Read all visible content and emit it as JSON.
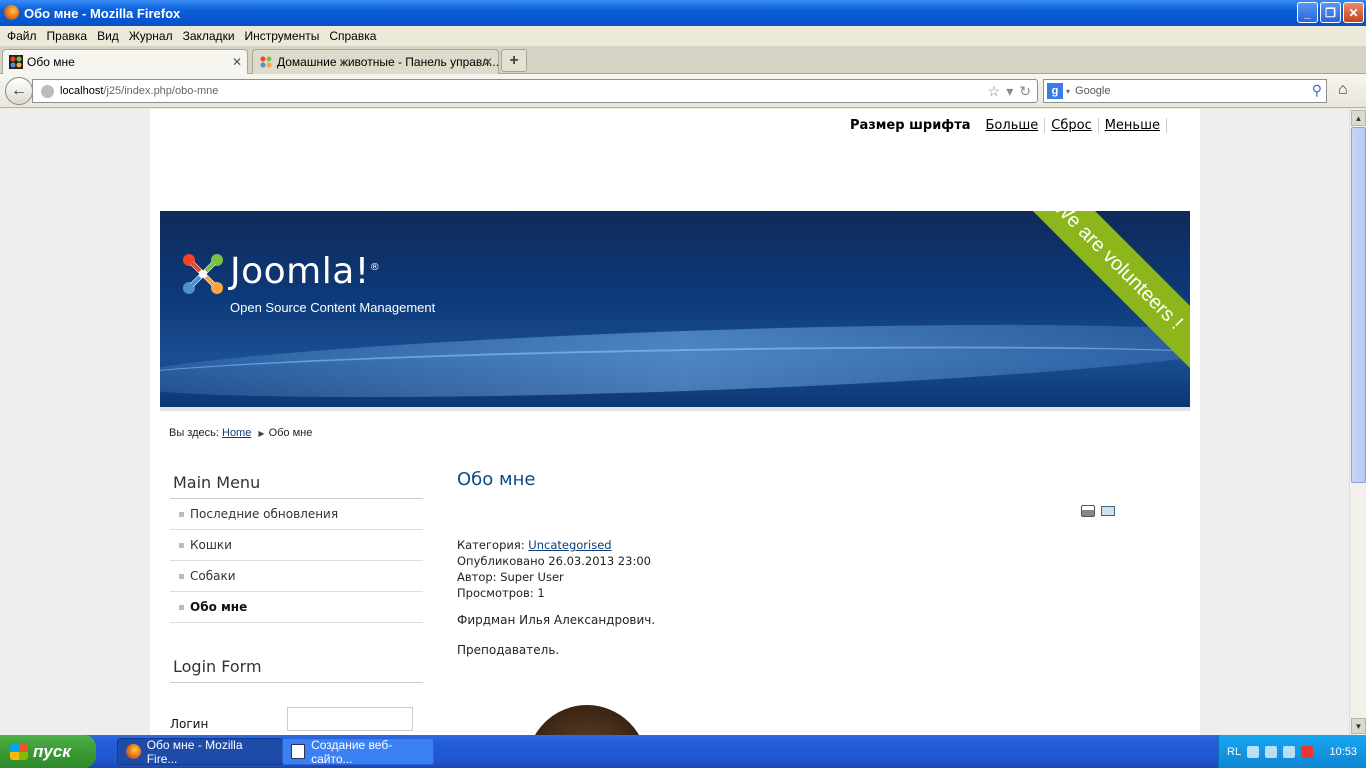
{
  "window": {
    "title": "Обо мне - Mozilla Firefox",
    "minimize": "_",
    "maximize": "❐",
    "close": "✕"
  },
  "menubar": [
    "Файл",
    "Правка",
    "Вид",
    "Журнал",
    "Закладки",
    "Инструменты",
    "Справка"
  ],
  "tabs": [
    {
      "label": "Обо мне",
      "close": "✕"
    },
    {
      "label": "Домашние животные - Панель управл...",
      "close": "✕"
    }
  ],
  "newtab": "+",
  "nav": {
    "back": "←",
    "url_host": "localhost",
    "url_path": "/j25/index.php/obo-mne",
    "star": "☆",
    "dropdown": "▾",
    "reload": "↻",
    "search_engine": "g",
    "search_placeholder": "Google",
    "search_icon": "⚲",
    "home": "⌂"
  },
  "site": {
    "fontsize_label": "Размер шрифта",
    "fontsize_bigger": "Больше",
    "fontsize_reset": "Сброс",
    "fontsize_smaller": "Меньше",
    "brand": "Joomla!",
    "brand_reg": "®",
    "tagline": "Open Source Content Management",
    "ribbon": "We are volunteers !",
    "breadcrumb_prefix": "Вы здесь:",
    "breadcrumb_home": "Home",
    "breadcrumb_current": "Обо мне"
  },
  "main_menu": {
    "title": "Main Menu",
    "items": [
      "Последние обновления",
      "Кошки",
      "Собаки",
      "Обо мне"
    ],
    "active_index": 3
  },
  "login": {
    "title": "Login Form",
    "username_label": "Логин"
  },
  "article": {
    "title": "Обо мне",
    "category_label": "Категория:",
    "category": "Uncategorised",
    "published": "Опубликовано 26.03.2013 23:00",
    "author": "Автор: Super User",
    "hits": "Просмотров: 1",
    "p1": "Фирдман Илья Александрович.",
    "p2": "Преподаватель."
  },
  "taskbar": {
    "start": "пуск",
    "tasks": [
      "Обо мне - Mozilla Fire...",
      "Создание веб-сайто..."
    ],
    "lang": "RL",
    "clock": "10:53"
  },
  "colors": {
    "accent": "#0b4a8c",
    "ribbon": "#8db51c",
    "banner": "#0d3a7a"
  }
}
